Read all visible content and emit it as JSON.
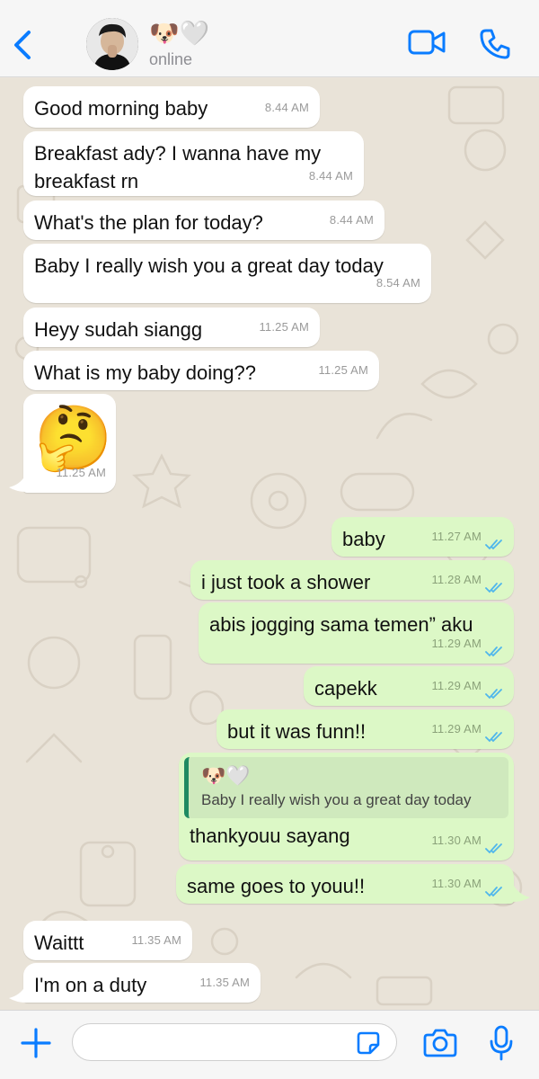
{
  "header": {
    "contact_name": "🐶🤍",
    "status": "online",
    "icons": [
      "chevron-left-icon",
      "avatar",
      "video-call-icon",
      "phone-call-icon"
    ]
  },
  "messages": [
    {
      "direction": "in",
      "text": "Good morning baby",
      "time": "8.44 AM"
    },
    {
      "direction": "in",
      "text": "Breakfast ady? I wanna have my breakfast rn",
      "time": "8.44 AM"
    },
    {
      "direction": "in",
      "text": "What's the plan for today?",
      "time": "8.44 AM"
    },
    {
      "direction": "in",
      "text": "Baby I really wish you a great day today",
      "time": "8.54 AM"
    },
    {
      "direction": "in",
      "text": "Heyy sudah siangg",
      "time": "11.25 AM"
    },
    {
      "direction": "in",
      "text": "What is my baby doing??",
      "time": "11.25 AM"
    },
    {
      "direction": "in",
      "text": "🤔",
      "time": "11.25 AM"
    },
    {
      "direction": "out",
      "text": "baby",
      "time": "11.27 AM"
    },
    {
      "direction": "out",
      "text": "i just took a shower",
      "time": "11.28 AM"
    },
    {
      "direction": "out",
      "text": "abis jogging sama temen” aku",
      "time": "11.29 AM"
    },
    {
      "direction": "out",
      "text": "capekk",
      "time": "11.29 AM"
    },
    {
      "direction": "out",
      "text": "but it was funn!!",
      "time": "11.29 AM"
    },
    {
      "direction": "out",
      "text": "thankyouu sayang",
      "time": "11.30 AM",
      "reply": {
        "author": "🐶🤍",
        "text": "Baby I really wish you a great day today"
      }
    },
    {
      "direction": "out",
      "text": "same goes to youu!!",
      "time": "11.30 AM"
    },
    {
      "direction": "in",
      "text": "Waittt",
      "time": "11.35 AM"
    },
    {
      "direction": "in",
      "text": "I'm on a duty",
      "time": "11.35 AM"
    }
  ],
  "input_bar": {
    "placeholder": "",
    "icons": [
      "plus-icon",
      "sticker-icon",
      "camera-icon",
      "microphone-icon"
    ]
  },
  "colors": {
    "accent": "#0a7cff",
    "incoming_bubble": "#ffffff",
    "outgoing_bubble": "#dcf8c6",
    "read_ticks": "#4fb6ec",
    "reply_bar": "#1f8a62",
    "background": "#e9e3d8"
  }
}
